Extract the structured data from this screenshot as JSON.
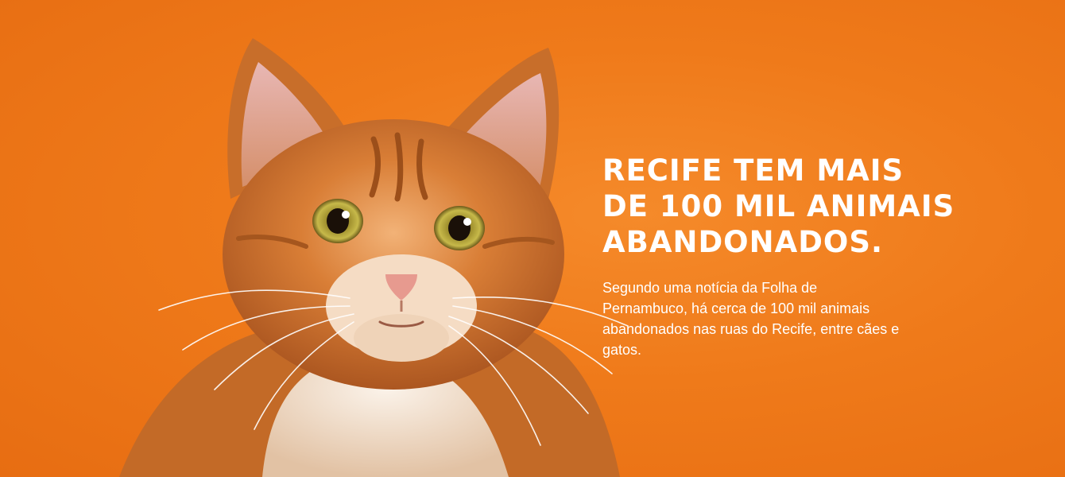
{
  "hero": {
    "image_subject": "ginger-kitten-photo",
    "background_color": "#EF7A1A",
    "headline_lines": [
      "RECIFE TEM MAIS",
      "DE 100 MIL ANIMAIS",
      "ABANDONADOS."
    ],
    "body": "Segundo uma notícia da Folha de Pernambuco, há cerca de 100 mil animais abandonados nas ruas do Recife, entre cães e gatos."
  }
}
